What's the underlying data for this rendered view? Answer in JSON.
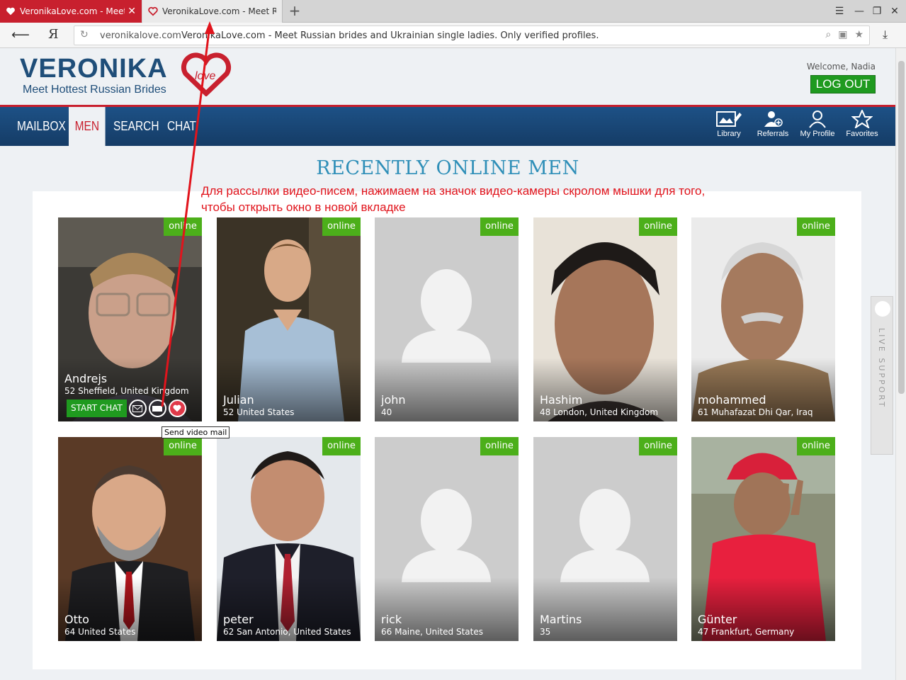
{
  "browser": {
    "tabs": [
      {
        "title": "VeronikaLove.com - Meet"
      },
      {
        "title": "VeronikaLove.com - Meet Ru"
      }
    ],
    "close_glyph": "✕",
    "new_tab_glyph": "+",
    "yandex": "Я",
    "url_host": "veronikalove.com",
    "url_title": "VeronikaLove.com - Meet Russian brides and Ukrainian single ladies. Only verified profiles."
  },
  "site": {
    "logo": "VERONIKA",
    "logo_heart_word": "love",
    "tagline": "Meet Hottest Russian Brides",
    "welcome": "Welcome, Nadia",
    "logout": "LOG OUT",
    "colors": {
      "brand_blue": "#1f4e79",
      "brand_red": "#c8202e",
      "online_green": "#4caf1a"
    }
  },
  "nav": {
    "items": [
      {
        "label": "MAILBOX"
      },
      {
        "label": "MEN"
      },
      {
        "label": "SEARCH"
      },
      {
        "label": "CHAT"
      }
    ],
    "icons": [
      {
        "label": "Library",
        "icon": "library-icon"
      },
      {
        "label": "Referrals",
        "icon": "referrals-icon"
      },
      {
        "label": "My Profile",
        "icon": "profile-icon"
      },
      {
        "label": "Favorites",
        "icon": "star-icon"
      }
    ]
  },
  "main": {
    "title": "RECENTLY ONLINE MEN",
    "annotation_line1": "Для рассылки видео-писем, нажимаем на значок видео-камеры скролом мышки для того,",
    "annotation_line2": "чтобы открыть окно в новой вкладке",
    "online_label": "online",
    "start_chat": "START CHAT",
    "tooltip": "Send video mail",
    "men": [
      {
        "name": "Andrejs",
        "location": "52 Sheffield, United Kingdom"
      },
      {
        "name": "Julian",
        "location": "52 United States"
      },
      {
        "name": "john",
        "location": "40"
      },
      {
        "name": "Hashim",
        "location": "48 London, United Kingdom"
      },
      {
        "name": "mohammed",
        "location": "61 Muhafazat Dhi Qar, Iraq"
      },
      {
        "name": "Otto",
        "location": "64 United States"
      },
      {
        "name": "peter",
        "location": "62 San Antonio, United States"
      },
      {
        "name": "rick",
        "location": "66 Maine, United States"
      },
      {
        "name": "Martins",
        "location": "35"
      },
      {
        "name": "Günter",
        "location": "47 Frankfurt, Germany"
      }
    ]
  },
  "live_support": "LIVE SUPPORT"
}
